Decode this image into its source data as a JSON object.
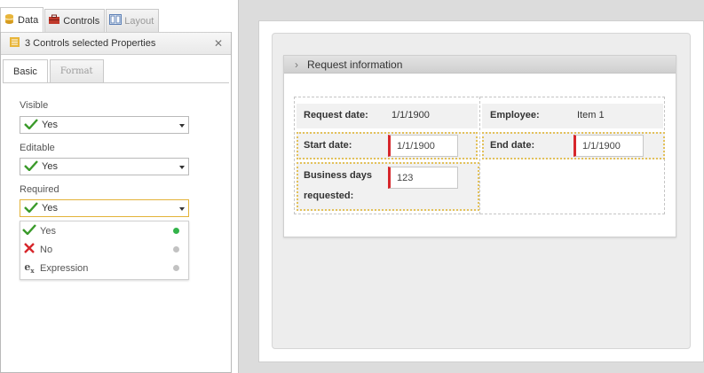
{
  "top_tabs": [
    {
      "label": "Data",
      "icon": "database-icon"
    },
    {
      "label": "Controls",
      "icon": "toolbox-icon"
    },
    {
      "label": "Layout",
      "icon": "layout-icon"
    }
  ],
  "panel": {
    "title": "3 Controls selected Properties",
    "close": "✕",
    "tabs": [
      "Basic",
      "Format"
    ]
  },
  "properties": {
    "visible": {
      "label": "Visible",
      "value": "Yes"
    },
    "editable": {
      "label": "Editable",
      "value": "Yes"
    },
    "required": {
      "label": "Required",
      "value": "Yes"
    }
  },
  "dropdown": {
    "options": [
      {
        "label": "Yes",
        "icon": "check-icon",
        "dot_color": "#33b34a"
      },
      {
        "label": "No",
        "icon": "x-icon",
        "dot_color": "#bbbbbb"
      },
      {
        "label": "Expression",
        "icon": "expression-icon",
        "dot_color": "#bbbbbb"
      }
    ]
  },
  "form": {
    "section_title": "Request information",
    "request_date_label": "Request date:",
    "request_date_value": "1/1/1900",
    "employee_label": "Employee:",
    "employee_value": "Item 1",
    "start_date_label": "Start date:",
    "start_date_value": "1/1/1900",
    "end_date_label": "End date:",
    "end_date_value": "1/1/1900",
    "business_days_label_1": "Business days",
    "business_days_label_2": "requested:",
    "business_days_value": "123"
  },
  "colors": {
    "required_marker": "#d7262b",
    "selection": "#e3c15a",
    "check_green": "#3a9a2a"
  }
}
